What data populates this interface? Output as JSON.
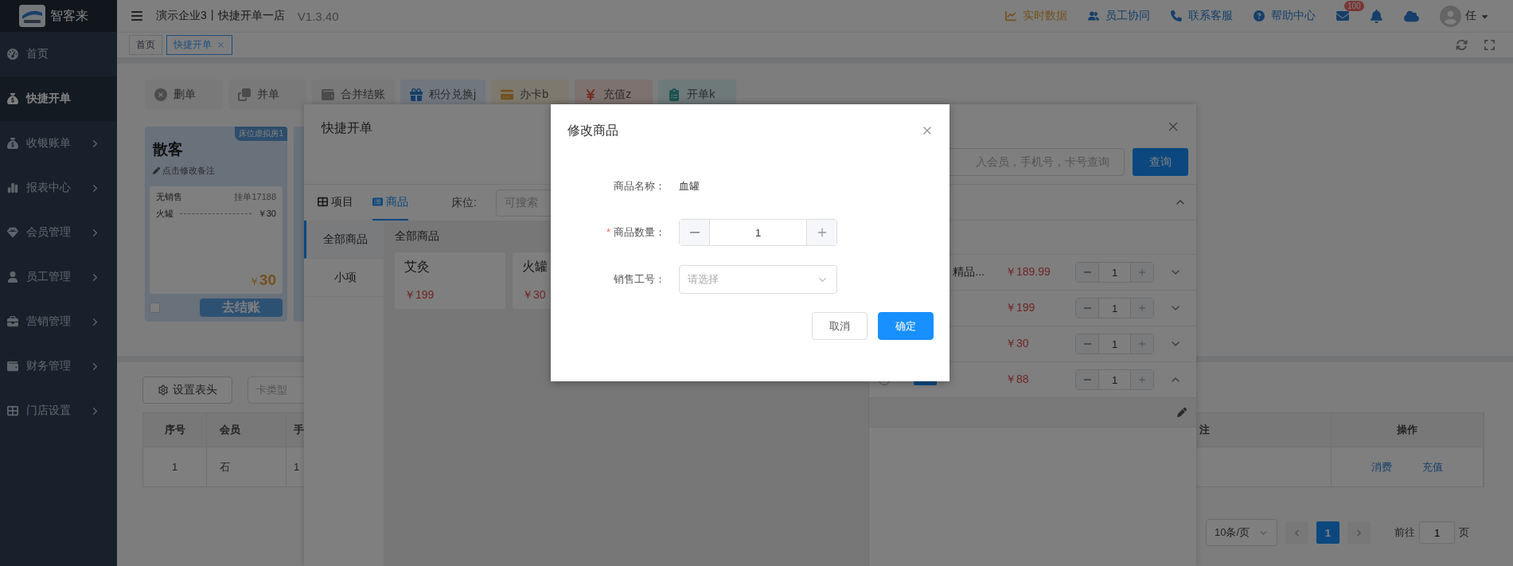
{
  "logo": {
    "text": "智客来"
  },
  "sidebar": {
    "items": [
      {
        "label": "首页",
        "selected": false,
        "expandable": false
      },
      {
        "label": "快捷开单",
        "selected": true,
        "expandable": false
      },
      {
        "label": "收银账单",
        "selected": false,
        "expandable": true
      },
      {
        "label": "报表中心",
        "selected": false,
        "expandable": true
      },
      {
        "label": "会员管理",
        "selected": false,
        "expandable": true
      },
      {
        "label": "员工管理",
        "selected": false,
        "expandable": true
      },
      {
        "label": "营销管理",
        "selected": false,
        "expandable": true
      },
      {
        "label": "财务管理",
        "selected": false,
        "expandable": true
      },
      {
        "label": "门店设置",
        "selected": false,
        "expandable": true
      }
    ]
  },
  "header": {
    "title": "演示企业3丨快捷开单一店",
    "version": "V1.3.40",
    "links": [
      {
        "label": "实时数据",
        "highlighted": true
      },
      {
        "label": "员工协同",
        "highlighted": false
      },
      {
        "label": "联系客服",
        "highlighted": false
      },
      {
        "label": "帮助中心",
        "highlighted": false
      }
    ],
    "mail_badge": "100",
    "user": "任"
  },
  "tabs": [
    {
      "label": "首页",
      "selected": false,
      "closable": false
    },
    {
      "label": "快捷开单",
      "selected": true,
      "closable": true
    }
  ],
  "toolbar": [
    {
      "label": "删单"
    },
    {
      "label": "并单"
    },
    {
      "label": "合并结账"
    },
    {
      "label": "积分兑换j"
    },
    {
      "label": "办卡b"
    },
    {
      "label": "充值z"
    },
    {
      "label": "开单k"
    }
  ],
  "order_card": {
    "name": "散客",
    "room_tag": "床位虚拟房1",
    "note": "点击修改备注",
    "sale_label": "无销售",
    "order_no": "挂单17188",
    "items": [
      {
        "name": "火罐",
        "price": "￥30"
      }
    ],
    "currency": "￥",
    "total": "30",
    "checkout": "去结账",
    "checked": false
  },
  "member_table": {
    "settings_button": "设置表头",
    "card_type_placeholder": "卡类型",
    "columns": [
      "序号",
      "会员",
      "手",
      "注",
      "操作"
    ],
    "rows": [
      {
        "cells": [
          "1",
          "石",
          "1"
        ],
        "actions": [
          "消费",
          "充值"
        ]
      }
    ],
    "pagination": {
      "page_size": "10条/页",
      "pages": [
        {
          "label": "1",
          "selected": true
        }
      ],
      "goto_label": "前往",
      "goto_value": "1",
      "goto_suffix": "页"
    }
  },
  "quick_order": {
    "title": "快捷开单",
    "tabs": [
      {
        "label": "项目",
        "selected": false
      },
      {
        "label": "商品",
        "selected": true
      }
    ],
    "bed_label": "床位:",
    "bed_placeholder": "可搜索",
    "categories": [
      {
        "label": "全部商品",
        "selected": true
      },
      {
        "label": "小项",
        "selected": false
      }
    ],
    "section_title": "全部商品",
    "products": [
      {
        "name": "艾灸",
        "price": "￥199"
      },
      {
        "name": "火罐",
        "price": "￥30"
      }
    ],
    "search_placeholder": "入会员，手机号，卡号查询",
    "search_button": "查询",
    "cart_rows": [
      {
        "name": "精品...",
        "price": "￥189.99",
        "qty": "1",
        "expanded": false,
        "tagged": false
      },
      {
        "price": "￥199",
        "qty": "1",
        "expanded": false,
        "tagged": false
      },
      {
        "price": "￥30",
        "qty": "1",
        "expanded": false,
        "tagged": false
      },
      {
        "price": "￥88",
        "qty": "1",
        "expanded": true,
        "tagged": true
      }
    ]
  },
  "edit_dialog": {
    "title": "修改商品",
    "name_label": "商品名称：",
    "name_value": "血罐",
    "qty_label": "商品数量：",
    "qty_required": true,
    "required_mark": "*",
    "qty": "1",
    "staff_label": "销售工号：",
    "staff_placeholder": "请选择",
    "cancel": "取消",
    "ok": "确定"
  }
}
